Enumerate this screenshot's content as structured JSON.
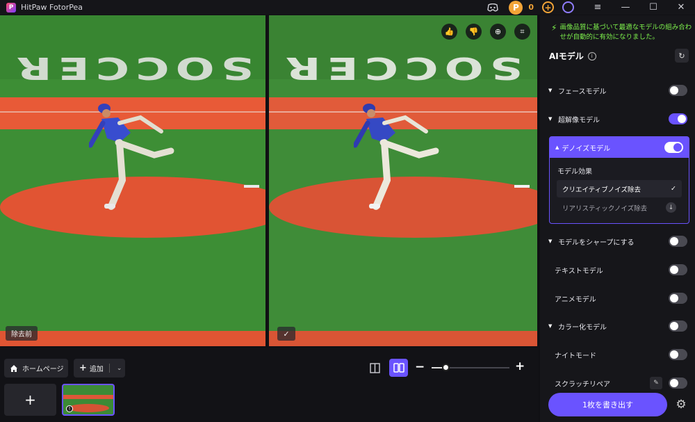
{
  "app": {
    "logo_letter": "P",
    "title": "HitPaw FotorPea"
  },
  "titlebar": {
    "coin_letter": "P",
    "coin_count": "0",
    "plus_glyph": "+",
    "menu_glyph": "≡",
    "minimize_glyph": "—",
    "maximize_glyph": "☐",
    "close_glyph": "✕"
  },
  "preview": {
    "before_label": "除去前",
    "stadium_text": "SOCCER",
    "after_check": "✓",
    "tools": {
      "like": "👍",
      "dislike": "👎",
      "zoom": "⊕",
      "crop": "⌗"
    }
  },
  "bottom": {
    "home_label": "ホームページ",
    "add_label": "追加",
    "add_plus": "+",
    "add_chevron": "⌄",
    "zoom_minus": "−",
    "zoom_plus": "+",
    "zoom_level": 0.18,
    "add_tile_glyph": "+",
    "thumb_info": "!"
  },
  "panel": {
    "notice": "画像品質に基づいて最適なモデルの組み合わせが自動的に有効になりました。",
    "ai_title": "AIモデル",
    "info_glyph": "i",
    "refresh_glyph": "↻",
    "rows": [
      {
        "label": "フェースモデル",
        "on": false
      },
      {
        "label": "超解像モデル",
        "on": true
      },
      {
        "label": "モデルをシャープにする",
        "on": false
      },
      {
        "label": "テキストモデル",
        "on": false
      },
      {
        "label": "アニメモデル",
        "on": false
      },
      {
        "label": "カラー化モデル",
        "on": false
      },
      {
        "label": "ナイトモード",
        "on": false
      },
      {
        "label": "スクラッチリペア",
        "on": false
      }
    ],
    "denoise": {
      "label": "デノイズモデル",
      "on": true,
      "effect_title": "モデル効果",
      "options": [
        {
          "label": "クリエイティブノイズ除去",
          "selected": true,
          "mark": "✓"
        },
        {
          "label": "リアリスティックノイズ除去",
          "selected": false,
          "mark": "↓"
        }
      ]
    },
    "export_label": "1枚を書き出す",
    "settings_glyph": "⚙"
  },
  "colors": {
    "accent": "#6a53ff",
    "notice": "#7df04c",
    "coin": "#f3a437",
    "clay": "#e15b3a",
    "grass": "#3f8c38"
  }
}
